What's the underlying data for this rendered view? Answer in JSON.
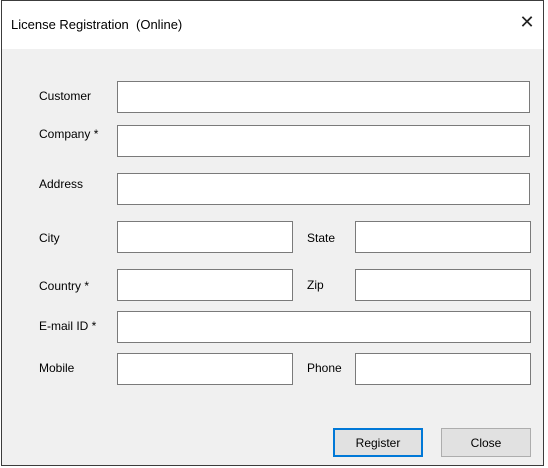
{
  "window": {
    "title": "License Registration  (Online)",
    "close_glyph": "✕"
  },
  "form": {
    "customer": {
      "label": "Customer",
      "value": ""
    },
    "company": {
      "label": "Company *",
      "value": ""
    },
    "address": {
      "label": "Address",
      "value": ""
    },
    "city": {
      "label": "City",
      "value": ""
    },
    "state": {
      "label": "State",
      "value": ""
    },
    "country": {
      "label": "Country *",
      "value": ""
    },
    "zip": {
      "label": "Zip",
      "value": ""
    },
    "email": {
      "label": "E-mail ID *",
      "value": ""
    },
    "mobile": {
      "label": "Mobile",
      "value": ""
    },
    "phone": {
      "label": "Phone",
      "value": ""
    }
  },
  "buttons": {
    "register": "Register",
    "close": "Close"
  },
  "colors": {
    "dialog_bg": "#f0f0f0",
    "default_button_border": "#0078d7"
  }
}
